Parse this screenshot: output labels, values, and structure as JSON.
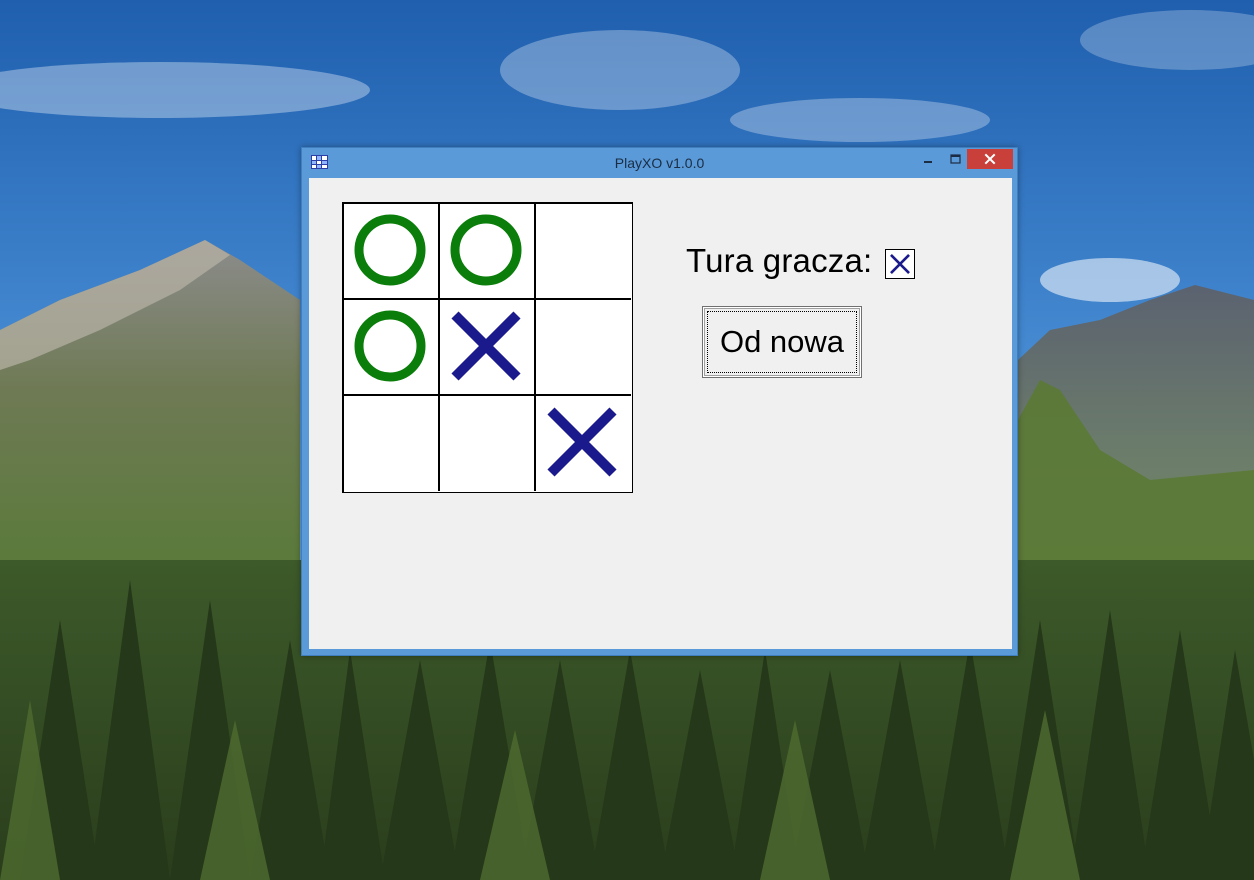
{
  "window": {
    "title": "PlayXO v1.0.0",
    "icons": {
      "app": "app-icon",
      "minimize": "minimize-icon",
      "maximize": "maximize-icon",
      "close": "close-icon"
    }
  },
  "board": {
    "cells": [
      "O",
      "O",
      "",
      "O",
      "X",
      "",
      "",
      "",
      "X"
    ],
    "colors": {
      "O": "#0a7d0a",
      "X": "#1a1a8c"
    }
  },
  "turn": {
    "label": "Tura gracza:",
    "current_player": "X"
  },
  "controls": {
    "restart_label": "Od nowa"
  },
  "colors": {
    "titlebar": "#5a9ad8",
    "close_button": "#c9403a",
    "client_bg": "#f0f0f0"
  }
}
